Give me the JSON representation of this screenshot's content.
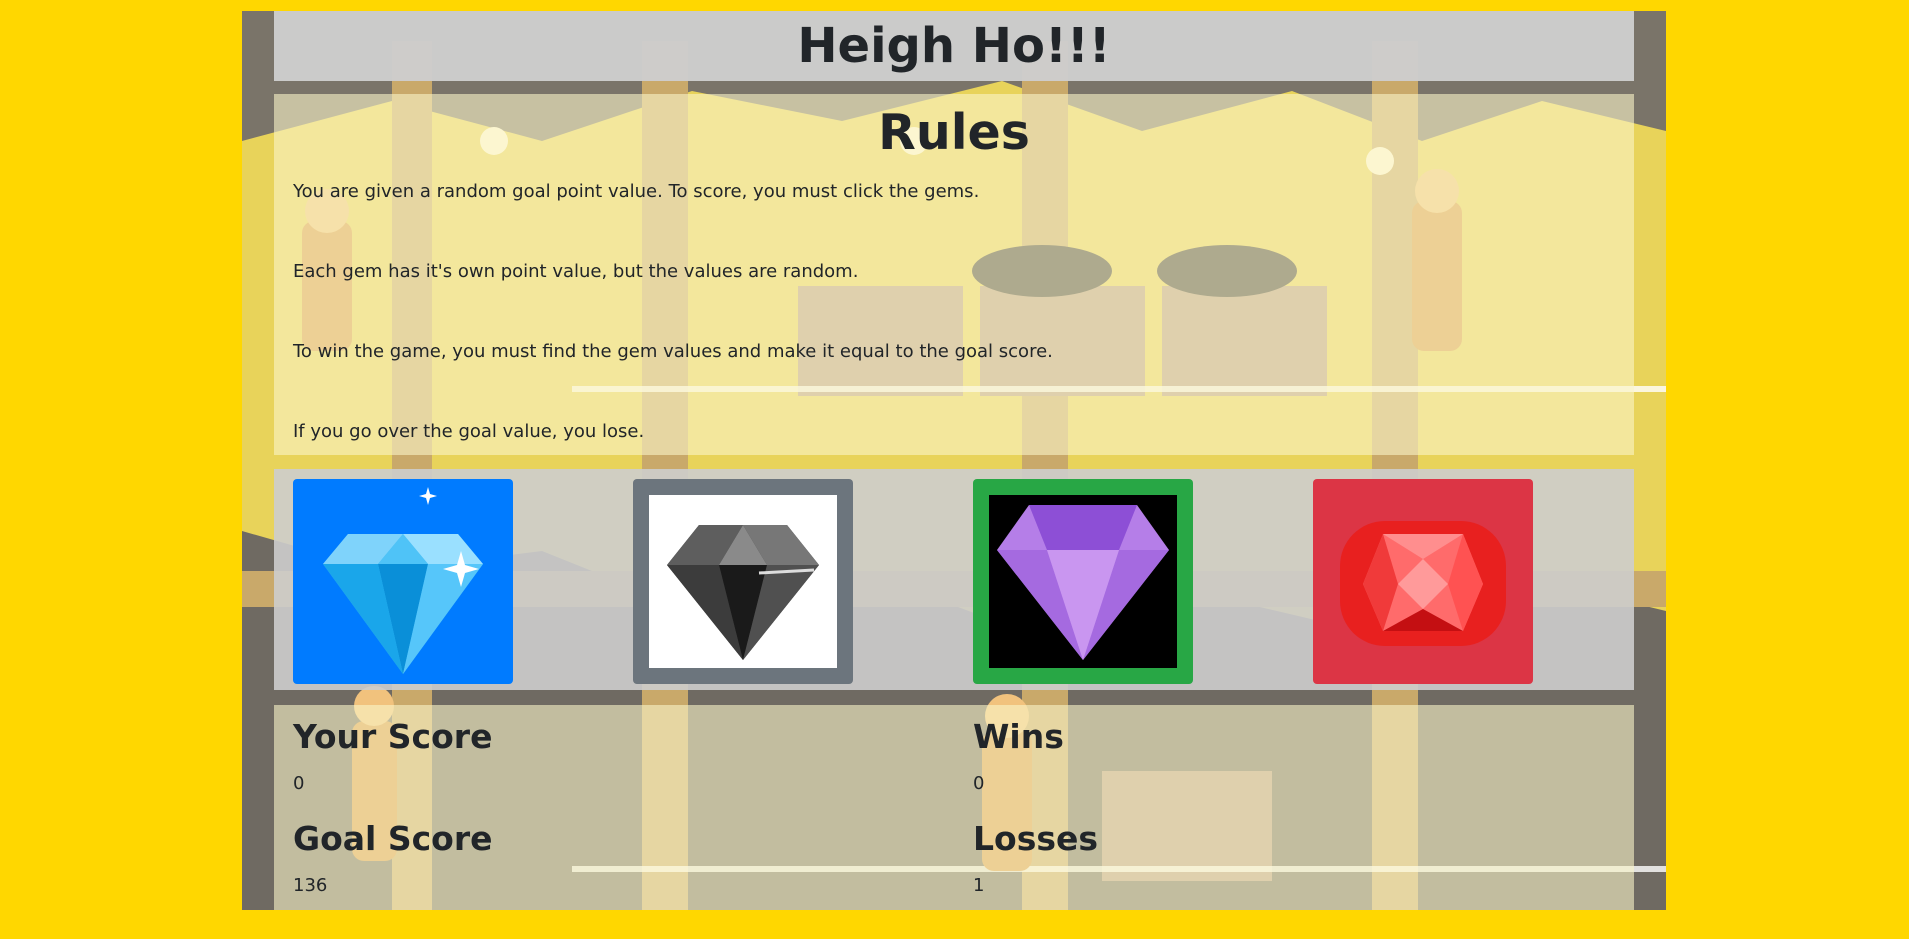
{
  "header": {
    "title": "Heigh Ho!!!"
  },
  "rules": {
    "title": "Rules",
    "items": [
      "You are given a random goal point value. To score, you must click the gems.",
      "Each gem has it's own point value, but the values are random.",
      "To win the game, you must find the gem values and make it equal to the goal score.",
      "If you go over the goal value, you lose."
    ]
  },
  "gems": [
    {
      "name": "blue-diamond",
      "color": "#007bff"
    },
    {
      "name": "black-diamond",
      "color": "#6c757d"
    },
    {
      "name": "purple-gem",
      "color": "#28a745"
    },
    {
      "name": "red-ruby",
      "color": "#dc3545"
    }
  ],
  "stats": {
    "your_score_label": "Your Score",
    "your_score": "0",
    "goal_score_label": "Goal Score",
    "goal_score": "136",
    "wins_label": "Wins",
    "wins": "0",
    "losses_label": "Losses",
    "losses": "1"
  },
  "colors": {
    "page_bg": "#FFD700",
    "frame": "#5a4d55"
  }
}
